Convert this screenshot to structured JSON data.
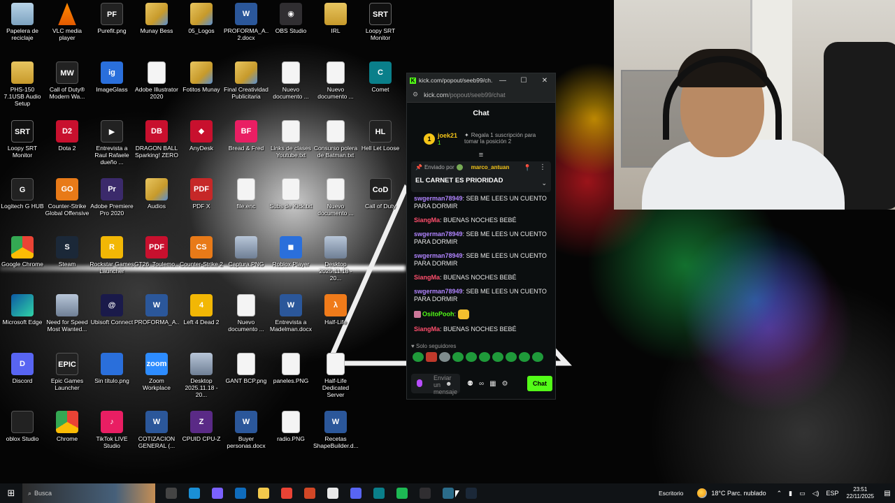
{
  "desktop_icons": [
    {
      "label": "Papelera de reciclaje",
      "icon": "recycle-bin-icon",
      "type": "t-recycle",
      "glyph": ""
    },
    {
      "label": "VLC media player",
      "icon": "vlc-icon",
      "type": "t-vlc",
      "glyph": ""
    },
    {
      "label": "Purefit.png",
      "icon": "image-file-icon",
      "type": "t-dark",
      "glyph": "PF"
    },
    {
      "label": "Munay Bess",
      "icon": "folder-icon",
      "type": "t-folder-img",
      "glyph": ""
    },
    {
      "label": "05_Logos",
      "icon": "folder-icon",
      "type": "t-folder-img",
      "glyph": ""
    },
    {
      "label": "PROFORMA_A...VITAIN 2.docx",
      "icon": "word-doc-icon",
      "type": "t-word",
      "glyph": "W"
    },
    {
      "label": "OBS Studio",
      "icon": "obs-icon",
      "type": "t-obs",
      "glyph": "◉"
    },
    {
      "label": "IRL",
      "icon": "folder-icon",
      "type": "t-folder",
      "glyph": ""
    },
    {
      "label": "Loopy SRT Monitor",
      "icon": "srt-icon",
      "type": "t-srt",
      "glyph": "SRT"
    },
    {
      "label": "PHS-150 7.1USB Audio Setup",
      "icon": "folder-icon",
      "type": "t-folder",
      "glyph": ""
    },
    {
      "label": "Call of Duty® Modern Wa...",
      "icon": "cod-icon",
      "type": "t-dark",
      "glyph": "MW"
    },
    {
      "label": "ImageGlass",
      "icon": "imageglass-icon",
      "type": "t-blue",
      "glyph": "ig"
    },
    {
      "label": "Adobe Illustrator 2020",
      "icon": "doc-icon",
      "type": "t-doc",
      "glyph": ""
    },
    {
      "label": "Fotitos Munay",
      "icon": "folder-icon",
      "type": "t-folder-img",
      "glyph": ""
    },
    {
      "label": "Final Creatividad Publicitaria",
      "icon": "folder-icon",
      "type": "t-folder-img",
      "glyph": ""
    },
    {
      "label": "Nuevo documento ...",
      "icon": "doc-icon",
      "type": "t-doc",
      "glyph": ""
    },
    {
      "label": "Nuevo documento ...",
      "icon": "doc-icon",
      "type": "t-doc",
      "glyph": ""
    },
    {
      "label": "Comet",
      "icon": "comet-icon",
      "type": "t-teal",
      "glyph": "C"
    },
    {
      "label": "Loopy SRT Monitor",
      "icon": "srt-icon",
      "type": "t-srt",
      "glyph": "SRT"
    },
    {
      "label": "Dota 2",
      "icon": "dota-icon",
      "type": "t-red",
      "glyph": "D2"
    },
    {
      "label": "Entrevista a Raul Rafaele dueño ...",
      "icon": "video-file-icon",
      "type": "t-dark",
      "glyph": "▶"
    },
    {
      "label": "DRAGON BALL Sparking! ZERO",
      "icon": "dragonball-icon",
      "type": "t-red",
      "glyph": "DB"
    },
    {
      "label": "AnyDesk",
      "icon": "anydesk-icon",
      "type": "t-red",
      "glyph": "◆"
    },
    {
      "label": "Bread & Fred",
      "icon": "game-icon",
      "type": "t-pink",
      "glyph": "BF"
    },
    {
      "label": "Links de clases Youtube.txt",
      "icon": "text-file-icon",
      "type": "t-doc",
      "glyph": ""
    },
    {
      "label": "Consurso polera de Batman.txt",
      "icon": "text-file-icon",
      "type": "t-doc",
      "glyph": ""
    },
    {
      "label": "Hell Let Loose",
      "icon": "hellletloose-icon",
      "type": "t-dark",
      "glyph": "HL"
    },
    {
      "label": "Logitech G HUB",
      "icon": "logitech-icon",
      "type": "t-dark",
      "glyph": "G"
    },
    {
      "label": "Counter-Strike Global Offensive",
      "icon": "csgo-icon",
      "type": "t-orange",
      "glyph": "GO"
    },
    {
      "label": "Adobe Premiere Pro 2020",
      "icon": "premiere-icon",
      "type": "t-purple",
      "glyph": "Pr"
    },
    {
      "label": "Audios",
      "icon": "folder-icon",
      "type": "t-folder-img",
      "glyph": ""
    },
    {
      "label": "PDF X",
      "icon": "pdfx-icon",
      "type": "t-pdfx",
      "glyph": "PDF"
    },
    {
      "label": "file.enc",
      "icon": "file-icon",
      "type": "t-doc",
      "glyph": ""
    },
    {
      "label": "Subs de Kick.txt",
      "icon": "text-file-icon",
      "type": "t-doc",
      "glyph": ""
    },
    {
      "label": "Nuevo documento ...",
      "icon": "doc-icon",
      "type": "t-doc",
      "glyph": ""
    },
    {
      "label": "Call of Duty",
      "icon": "cod-icon",
      "type": "t-dark",
      "glyph": "CoD"
    },
    {
      "label": "Google Chrome",
      "icon": "chrome-icon",
      "type": "t-chrome",
      "glyph": ""
    },
    {
      "label": "Steam",
      "icon": "steam-icon",
      "type": "t-steam",
      "glyph": "S"
    },
    {
      "label": "Rockstar Games Launcher",
      "icon": "rockstar-icon",
      "type": "t-yellow",
      "glyph": "R"
    },
    {
      "label": "GT26_Toulemo...",
      "icon": "pdf-icon",
      "type": "t-red",
      "glyph": "PDF"
    },
    {
      "label": "Counter-Strike 2",
      "icon": "cs2-icon",
      "type": "t-orange",
      "glyph": "CS"
    },
    {
      "label": "Captura.PNG",
      "icon": "image-file-icon",
      "type": "t-img",
      "glyph": ""
    },
    {
      "label": "Roblox Player",
      "icon": "roblox-icon",
      "type": "t-blue",
      "glyph": "◼"
    },
    {
      "label": "Desktop 2025.11.18 - 20...",
      "icon": "video-file-icon",
      "type": "t-img",
      "glyph": ""
    },
    {
      "label": "",
      "icon": "",
      "type": "",
      "glyph": ""
    },
    {
      "label": "Microsoft Edge",
      "icon": "edge-icon",
      "type": "t-edge",
      "glyph": ""
    },
    {
      "label": "Need for Speed Most Wanted...",
      "icon": "nfs-icon",
      "type": "t-img",
      "glyph": ""
    },
    {
      "label": "Ubisoft Connect",
      "icon": "ubisoft-icon",
      "type": "t-ubi",
      "glyph": "@"
    },
    {
      "label": "PROFORMA_A...VITAIN.docx",
      "icon": "word-doc-icon",
      "type": "t-word",
      "glyph": "W"
    },
    {
      "label": "Left 4 Dead 2",
      "icon": "l4d2-icon",
      "type": "t-yellow",
      "glyph": "4"
    },
    {
      "label": "Nuevo documento ...",
      "icon": "doc-icon",
      "type": "t-doc",
      "glyph": ""
    },
    {
      "label": "Entrevista a Madelman.docx",
      "icon": "word-doc-icon",
      "type": "t-word",
      "glyph": "W"
    },
    {
      "label": "Half-Life",
      "icon": "halflife-icon",
      "type": "t-halflife",
      "glyph": "λ"
    },
    {
      "label": "",
      "icon": "",
      "type": "",
      "glyph": ""
    },
    {
      "label": "Discord",
      "icon": "discord-icon",
      "type": "t-discord",
      "glyph": "D"
    },
    {
      "label": "Epic Games Launcher",
      "icon": "epic-icon",
      "type": "t-dark",
      "glyph": "EPIC"
    },
    {
      "label": "Sin título.png",
      "icon": "image-file-icon",
      "type": "t-blue",
      "glyph": ""
    },
    {
      "label": "Zoom Workplace",
      "icon": "zoom-icon",
      "type": "t-zoom",
      "glyph": "zoom"
    },
    {
      "label": "Desktop 2025.11.18 - 20...",
      "icon": "video-file-icon",
      "type": "t-img",
      "glyph": ""
    },
    {
      "label": "GANT BCP.png",
      "icon": "image-file-icon",
      "type": "t-doc",
      "glyph": ""
    },
    {
      "label": "paneles.PNG",
      "icon": "image-file-icon",
      "type": "t-doc",
      "glyph": ""
    },
    {
      "label": "Half-Life Dedicated Server",
      "icon": "doc-icon",
      "type": "t-doc",
      "glyph": ""
    },
    {
      "label": "",
      "icon": "",
      "type": "",
      "glyph": ""
    },
    {
      "label": "oblox Studio",
      "icon": "roblox-studio-icon",
      "type": "t-dark",
      "glyph": ""
    },
    {
      "label": "Chrome",
      "icon": "chrome-icon",
      "type": "t-chrome",
      "glyph": ""
    },
    {
      "label": "TikTok LIVE Studio",
      "icon": "tiktok-icon",
      "type": "t-pink",
      "glyph": "♪"
    },
    {
      "label": "COTIZACION GENERAL (...",
      "icon": "word-doc-icon",
      "type": "t-word",
      "glyph": "W"
    },
    {
      "label": "CPUID CPU-Z",
      "icon": "cpuz-icon",
      "type": "t-cpuz",
      "glyph": "Z"
    },
    {
      "label": "Buyer personas.docx",
      "icon": "word-doc-icon",
      "type": "t-word",
      "glyph": "W"
    },
    {
      "label": "radio.PNG",
      "icon": "image-file-icon",
      "type": "t-doc",
      "glyph": ""
    },
    {
      "label": "Recetas ShapeBuilder.d...",
      "icon": "word-doc-icon",
      "type": "t-word",
      "glyph": "W"
    },
    {
      "label": "",
      "icon": "",
      "type": "",
      "glyph": ""
    }
  ],
  "chat_window": {
    "title": "kick.com/popout/seeb99/ch...",
    "favicon": "K",
    "minimize": "—",
    "maximize": "☐",
    "close": "✕",
    "url_host": "kick.com",
    "url_path": "/popout/seeb99/chat",
    "header": "Chat",
    "leaderboard": {
      "rank": "1",
      "user": "joek21",
      "count": "1",
      "gift_text": "Regala 1 suscripción para tomar la posición 2"
    },
    "pinned": {
      "sent_by_label": "Enviado por",
      "user": "marco_antuan",
      "message": "EL CARNET ES PRIORIDAD"
    },
    "messages": [
      {
        "user": "swgerman78949",
        "color": "#b084ff",
        "text": ": SEB ME LEES UN CUENTO PARA DORMIR"
      },
      {
        "user": "SiangMa",
        "color": "#ff4f6d",
        "text": ": BUENAS NOCHES BEBÉ"
      },
      {
        "user": "swgerman78949",
        "color": "#b084ff",
        "text": ": SEB ME LEES UN CUENTO PARA DORMIR"
      },
      {
        "user": "swgerman78949",
        "color": "#b084ff",
        "text": ": SEB ME LEES UN CUENTO PARA DORMIR"
      },
      {
        "user": "SiangMa",
        "color": "#ff4f6d",
        "text": ": BUENAS NOCHES BEBÉ"
      },
      {
        "user": "swgerman78949",
        "color": "#b084ff",
        "text": ": SEB ME LEES UN CUENTO PARA DORMIR"
      },
      {
        "user": "OsitoPooh",
        "color": "#53fc18",
        "text": ":"
      },
      {
        "user": "SiangMa",
        "color": "#ff4f6d",
        "text": ": BUENAS NOCHES BEBÉ"
      }
    ],
    "followers_only": "Solo seguidores",
    "input_placeholder": "Enviar un mensaje",
    "send_label": "Chat"
  },
  "taskbar": {
    "search_text": "Busca",
    "escritorio": "Escritorio",
    "weather_temp": "18°C",
    "weather_desc": "Parc. nublado",
    "lang": "ESP",
    "time": "23:51",
    "date": "22/11/2025",
    "apps": [
      {
        "name": "task-view-icon",
        "color": "#444"
      },
      {
        "name": "edge-icon",
        "color": "#1a8fd6"
      },
      {
        "name": "copilot-icon",
        "color": "#7b61ff"
      },
      {
        "name": "outlook-icon",
        "color": "#0f6cbd"
      },
      {
        "name": "file-explorer-icon",
        "color": "#f2c94c"
      },
      {
        "name": "chrome-icon",
        "color": "#ea4335"
      },
      {
        "name": "powerpoint-icon",
        "color": "#d24726"
      },
      {
        "name": "notepad-icon",
        "color": "#e8e8e8"
      },
      {
        "name": "discord-icon",
        "color": "#5865f2"
      },
      {
        "name": "comet-icon",
        "color": "#0a7f8a"
      },
      {
        "name": "spotify-icon",
        "color": "#1db954"
      },
      {
        "name": "obs-icon",
        "color": "#302e31"
      },
      {
        "name": "kick-window-icon",
        "color": "#2b6c8a"
      },
      {
        "name": "steam-icon",
        "color": "#1b2838"
      }
    ]
  }
}
